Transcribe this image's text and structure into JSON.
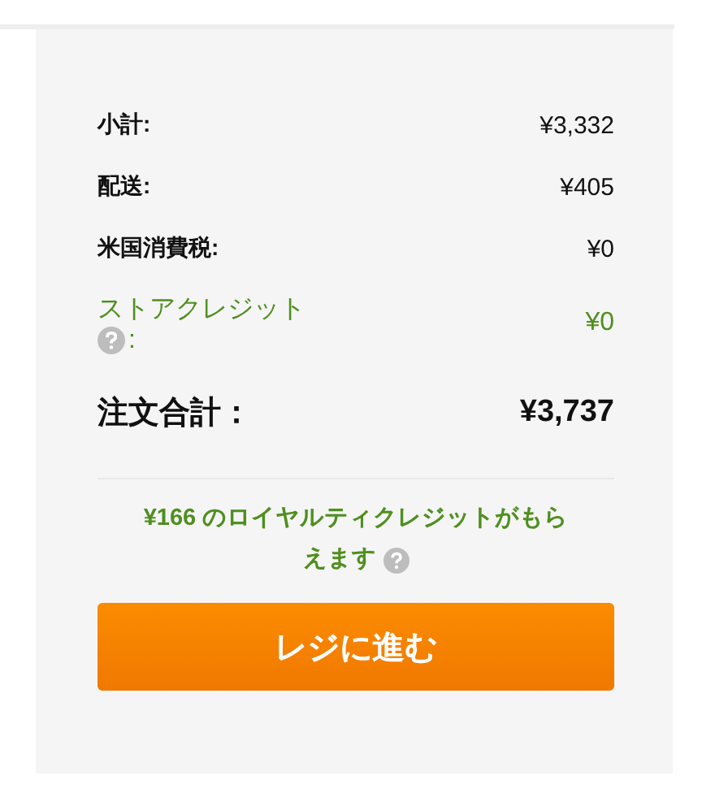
{
  "summary": {
    "rows": [
      {
        "kind": "plain",
        "label": "小計:",
        "value": "¥3,332"
      },
      {
        "kind": "plain",
        "label": "配送:",
        "value": "¥405"
      },
      {
        "kind": "plain",
        "label": "米国消費税:",
        "value": "¥0"
      },
      {
        "kind": "credit",
        "label": "ストアクレジット",
        "suffix": ":",
        "value": "¥0"
      },
      {
        "kind": "total",
        "label": "注文合計：",
        "value": "¥3,737"
      }
    ],
    "loyalty_note_lines": [
      "¥166 のロイヤルティクレジットがもら",
      "えます"
    ],
    "checkout_button": "レジに進む"
  }
}
